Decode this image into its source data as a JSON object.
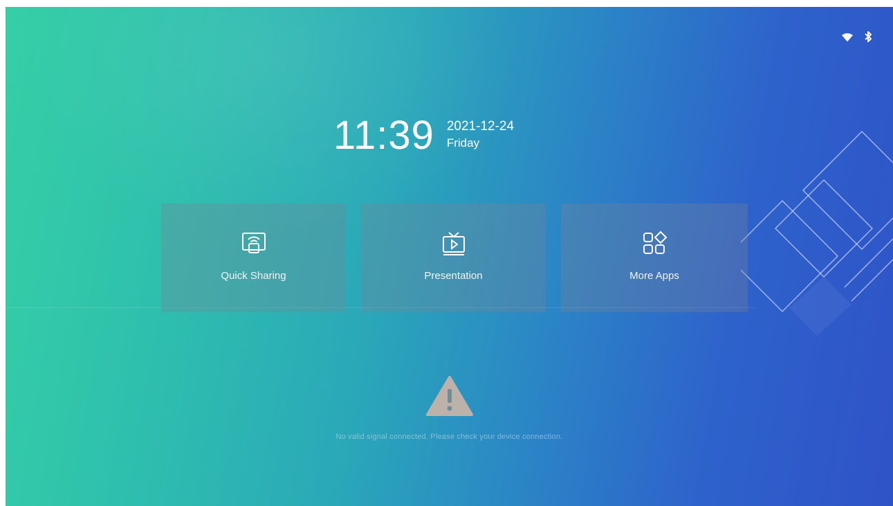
{
  "status_bar": {
    "wifi_icon": "wifi-icon",
    "bluetooth_icon": "bluetooth-icon"
  },
  "clock": {
    "time": "11:39",
    "date": "2021-12-24",
    "weekday": "Friday"
  },
  "tiles": [
    {
      "label": "Quick Sharing",
      "icon": "screen-cast-icon"
    },
    {
      "label": "Presentation",
      "icon": "tv-play-icon"
    },
    {
      "label": "More Apps",
      "icon": "app-grid-icon"
    }
  ],
  "warning": {
    "icon": "warning-triangle-icon",
    "message": "No valid signal connected. Please check your device connection."
  },
  "colors": {
    "gradient_start": "#35cfa6",
    "gradient_end": "#2f53c7",
    "tile_bg": "rgba(120,130,150,0.32)",
    "warning_icon": "#b9b0a8"
  }
}
